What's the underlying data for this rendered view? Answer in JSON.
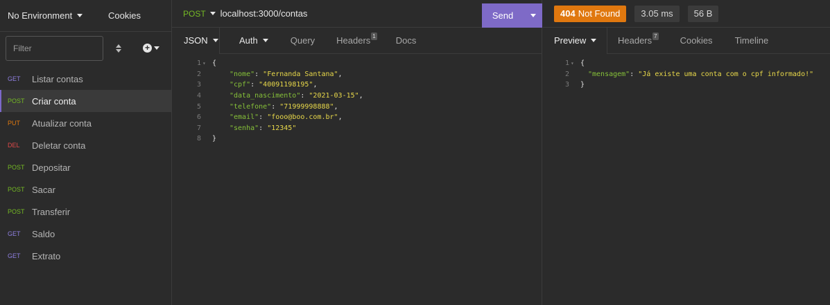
{
  "sidebar": {
    "environment": "No Environment",
    "cookies": "Cookies",
    "filter_placeholder": "Filter",
    "requests": [
      {
        "method": "GET",
        "method_color": "#8f7fe0",
        "label": "Listar contas"
      },
      {
        "method": "POST",
        "method_color": "#75ba24",
        "label": "Criar conta"
      },
      {
        "method": "PUT",
        "method_color": "#e0780f",
        "label": "Atualizar conta"
      },
      {
        "method": "DEL",
        "method_color": "#e14a4a",
        "label": "Deletar conta"
      },
      {
        "method": "POST",
        "method_color": "#75ba24",
        "label": "Depositar"
      },
      {
        "method": "POST",
        "method_color": "#75ba24",
        "label": "Sacar"
      },
      {
        "method": "POST",
        "method_color": "#75ba24",
        "label": "Transferir"
      },
      {
        "method": "GET",
        "method_color": "#8f7fe0",
        "label": "Saldo"
      },
      {
        "method": "GET",
        "method_color": "#8f7fe0",
        "label": "Extrato"
      }
    ],
    "active_index": 1
  },
  "request": {
    "method": "POST",
    "url": "localhost:3000/contas",
    "send_label": "Send",
    "tabs": {
      "body": "JSON",
      "auth": "Auth",
      "query": "Query",
      "headers": "Headers",
      "headers_count": "1",
      "docs": "Docs"
    },
    "body_lines": [
      {
        "n": "1",
        "fold": true,
        "text": "{"
      },
      {
        "n": "2",
        "key": "\"nome\"",
        "value": "\"Fernanda Santana\"",
        "trail": ","
      },
      {
        "n": "3",
        "key": "\"cpf\"",
        "value": "\"40091198195\"",
        "trail": ","
      },
      {
        "n": "4",
        "key": "\"data_nascimento\"",
        "value": "\"2021-03-15\"",
        "trail": ","
      },
      {
        "n": "5",
        "key": "\"telefone\"",
        "value": "\"71999998888\"",
        "trail": ","
      },
      {
        "n": "6",
        "key": "\"email\"",
        "value": "\"fooo@boo.com.br\"",
        "trail": ","
      },
      {
        "n": "7",
        "key": "\"senha\"",
        "value": "\"12345\"",
        "trail": ""
      },
      {
        "n": "8",
        "text": "}"
      }
    ]
  },
  "response": {
    "status_code": "404",
    "status_text": "Not Found",
    "time": "3.05 ms",
    "size": "56 B",
    "tabs": {
      "preview": "Preview",
      "headers": "Headers",
      "headers_count": "7",
      "cookies": "Cookies",
      "timeline": "Timeline"
    },
    "body_lines": [
      {
        "n": "1",
        "fold": true,
        "text": "{"
      },
      {
        "n": "2",
        "key": "\"mensagem\"",
        "value": "\"Já existe uma conta com o cpf informado!\"",
        "trail": ""
      },
      {
        "n": "3",
        "text": "}"
      }
    ]
  },
  "colors": {
    "accent": "#7e6ac7",
    "status_404": "#e0780f",
    "json_key": "#86c139",
    "json_string": "#e8d84a"
  }
}
